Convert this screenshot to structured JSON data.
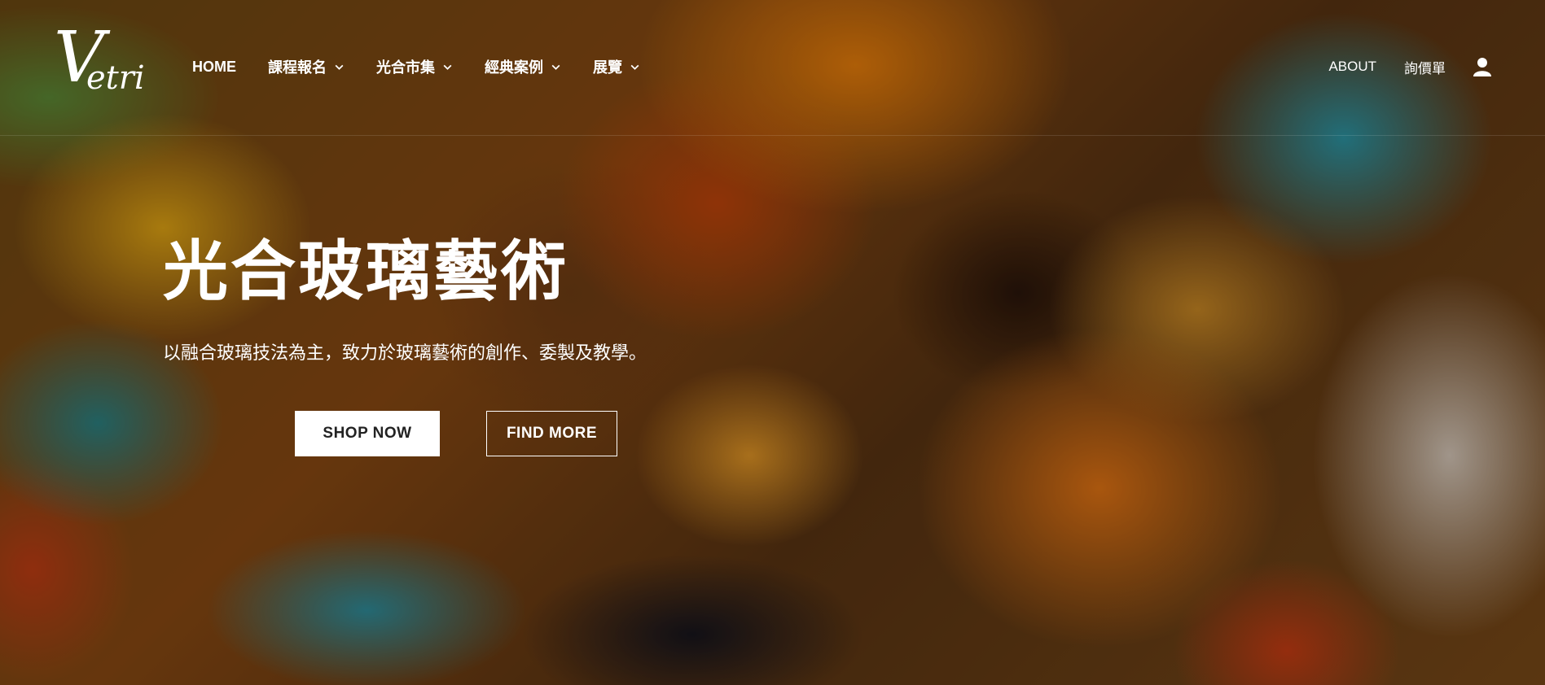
{
  "brand": {
    "logo_text": "Vetri"
  },
  "nav": {
    "items": [
      {
        "label": "HOME",
        "has_dropdown": false
      },
      {
        "label": "課程報名",
        "has_dropdown": true
      },
      {
        "label": "光合市集",
        "has_dropdown": true
      },
      {
        "label": "經典案例",
        "has_dropdown": true
      },
      {
        "label": "展覽",
        "has_dropdown": true
      }
    ],
    "right": {
      "about": "ABOUT",
      "quote": "詢價單",
      "user_icon": "user-icon"
    }
  },
  "hero": {
    "title": "光合玻璃藝術",
    "subtitle": "以融合玻璃技法為主，致力於玻璃藝術的創作、委製及教學。",
    "primary_button": "SHOP NOW",
    "secondary_button": "FIND MORE"
  },
  "colors": {
    "text": "#ffffff",
    "button_bg": "#ffffff",
    "button_text": "#222222"
  }
}
